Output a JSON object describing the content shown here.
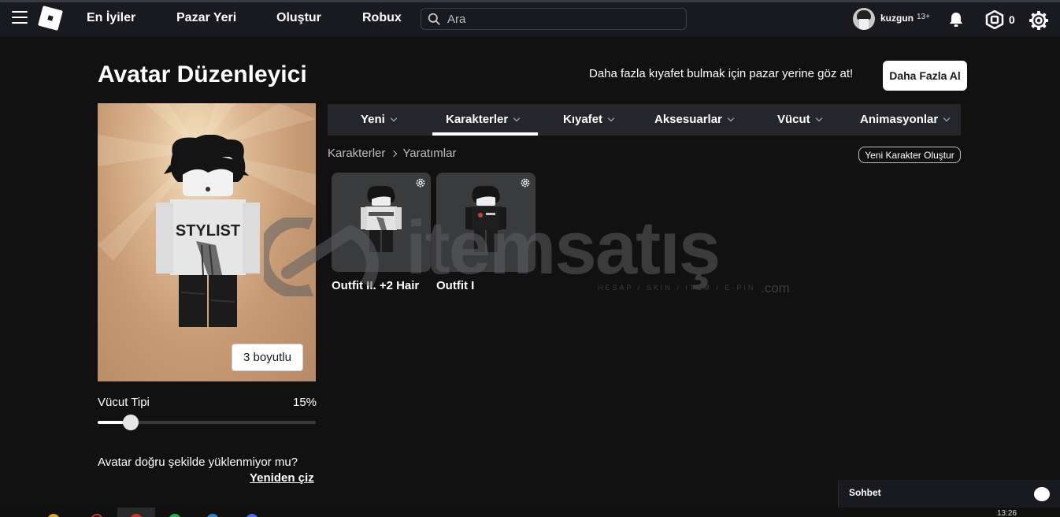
{
  "nav": {
    "links": [
      "En İyiler",
      "Pazar Yeri",
      "Oluştur",
      "Robux"
    ],
    "search_placeholder": "Ara",
    "username": "kuzgun",
    "age_badge": "13+",
    "robux": "0"
  },
  "header": {
    "title": "Avatar Düzenleyici",
    "promo_text": "Daha fazla kıyafet bulmak için pazar yerine göz at!",
    "get_more_label": "Daha Fazla Al"
  },
  "avatar": {
    "view_toggle_label": "3 boyutlu",
    "body_type_label": "Vücut Tipi",
    "body_type_value": "15%",
    "body_type_fraction": 0.15,
    "load_message": "Avatar doğru şekilde yüklenmiyor mu?",
    "redraw_label": "Yeniden çiz",
    "shirt_text": "STYLIST"
  },
  "tabs": [
    {
      "label": "Yeni"
    },
    {
      "label": "Karakterler",
      "selected": true
    },
    {
      "label": "Kıyafet"
    },
    {
      "label": "Aksesuarlar"
    },
    {
      "label": "Vücut"
    },
    {
      "label": "Animasyonlar"
    }
  ],
  "breadcrumb": [
    "Karakterler",
    "Yaratımlar"
  ],
  "new_character_label": "Yeni Karakter Oluştur",
  "outfits": [
    {
      "name": "Outfit II. +2 Hair"
    },
    {
      "name": "Outfit I"
    }
  ],
  "watermark": {
    "text": "itemsatış",
    "subtext": "HESAP / SKIN / ITEM / E-PIN",
    "suffix": ".com"
  },
  "chat": {
    "label": "Sohbet"
  },
  "taskbar": {
    "clock": "13:26"
  },
  "colors": {
    "background": "#111112",
    "topbar": "#191a1f",
    "tab_bar": "#25262c",
    "card": "#393b3d"
  }
}
